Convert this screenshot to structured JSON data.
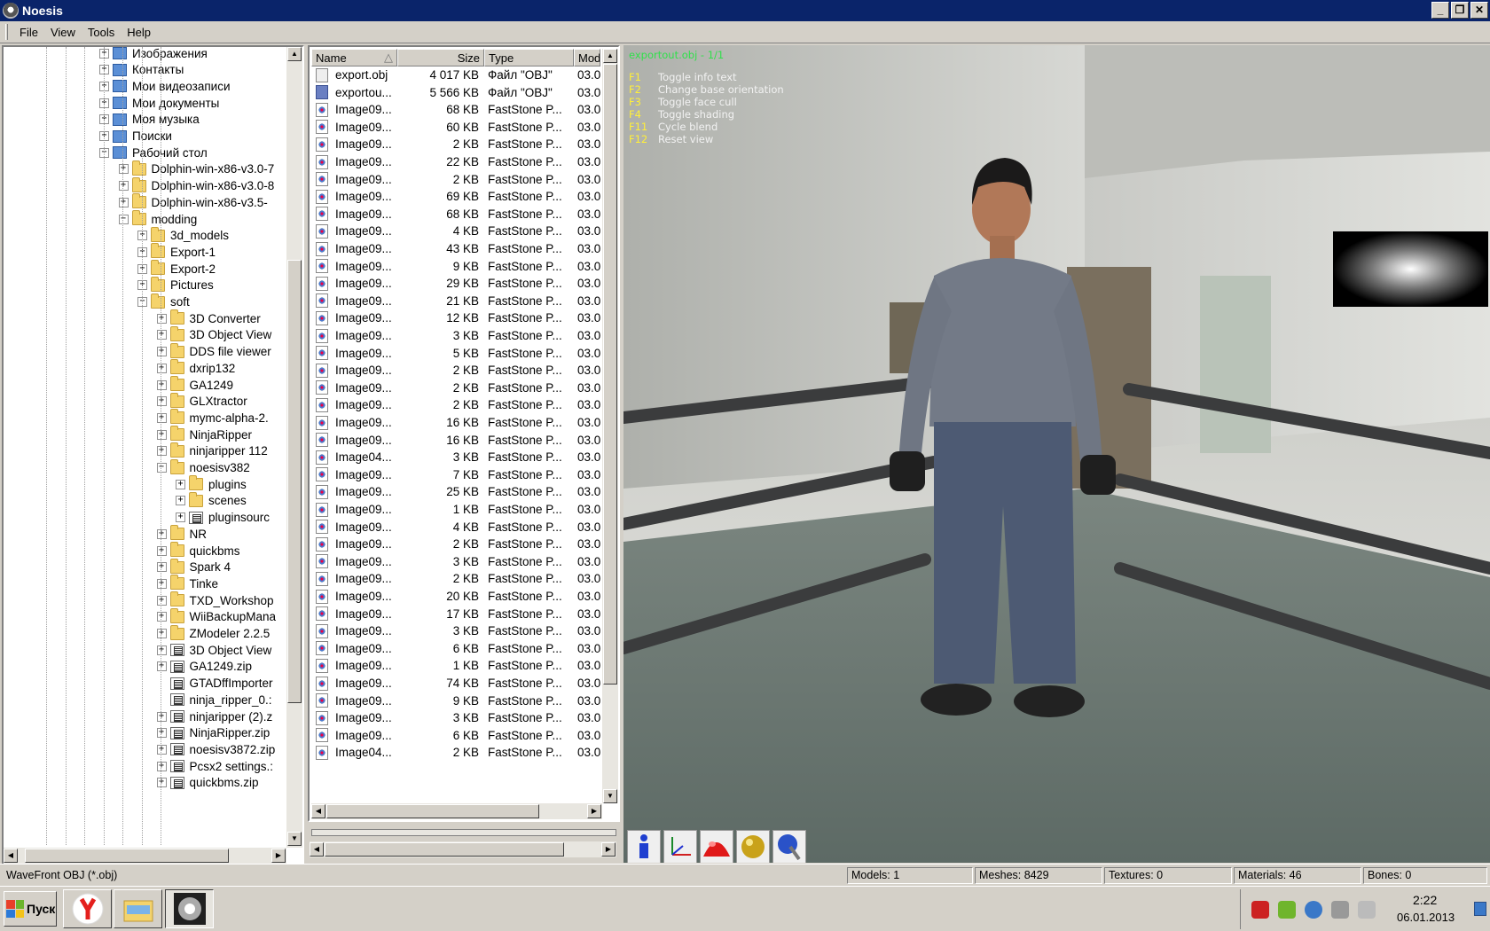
{
  "window": {
    "title": "Noesis",
    "min": "_",
    "max": "❐",
    "close": "✕"
  },
  "menu": [
    "File",
    "View",
    "Tools",
    "Help"
  ],
  "tree": {
    "items": [
      {
        "label": "Изображения",
        "icon": "sys",
        "exp": "+"
      },
      {
        "label": "Контакты",
        "icon": "sys",
        "exp": "+"
      },
      {
        "label": "Мои видеозаписи",
        "icon": "sys",
        "exp": "+"
      },
      {
        "label": "Мои документы",
        "icon": "sys",
        "exp": "+"
      },
      {
        "label": "Моя музыка",
        "icon": "sys",
        "exp": "+"
      },
      {
        "label": "Поиски",
        "icon": "sys",
        "exp": "+"
      },
      {
        "label": "Рабочий стол",
        "icon": "sys",
        "exp": "−"
      },
      {
        "label": "Dolphin-win-x86-v3.0-7",
        "icon": "folder",
        "exp": "+"
      },
      {
        "label": "Dolphin-win-x86-v3.0-8",
        "icon": "folder",
        "exp": "+"
      },
      {
        "label": "Dolphin-win-x86-v3.5-",
        "icon": "folder",
        "exp": "+"
      },
      {
        "label": "modding",
        "icon": "folder",
        "exp": "−"
      },
      {
        "label": "3d_models",
        "icon": "folder",
        "exp": "+"
      },
      {
        "label": "Export-1",
        "icon": "folder",
        "exp": "+"
      },
      {
        "label": "Export-2",
        "icon": "folder",
        "exp": "+"
      },
      {
        "label": "Pictures",
        "icon": "folder",
        "exp": "+"
      },
      {
        "label": "soft",
        "icon": "folder",
        "exp": "−"
      },
      {
        "label": "3D Converter",
        "icon": "folder",
        "exp": "+"
      },
      {
        "label": "3D Object View",
        "icon": "folder",
        "exp": "+"
      },
      {
        "label": "DDS file viewer",
        "icon": "folder",
        "exp": "+"
      },
      {
        "label": "dxrip132",
        "icon": "folder",
        "exp": "+"
      },
      {
        "label": "GA1249",
        "icon": "folder",
        "exp": "+"
      },
      {
        "label": "GLXtractor",
        "icon": "folder",
        "exp": "+"
      },
      {
        "label": "mymc-alpha-2.",
        "icon": "folder",
        "exp": "+"
      },
      {
        "label": "NinjaRipper",
        "icon": "folder",
        "exp": "+"
      },
      {
        "label": "ninjaripper 112",
        "icon": "folder",
        "exp": "+"
      },
      {
        "label": "noesisv382",
        "icon": "folder",
        "exp": "−"
      },
      {
        "label": "plugins",
        "icon": "folder",
        "exp": "+"
      },
      {
        "label": "scenes",
        "icon": "folder",
        "exp": "+"
      },
      {
        "label": "pluginsourc",
        "icon": "zip",
        "exp": "+"
      },
      {
        "label": "NR",
        "icon": "folder",
        "exp": "+"
      },
      {
        "label": "quickbms",
        "icon": "folder",
        "exp": "+"
      },
      {
        "label": "Spark 4",
        "icon": "folder",
        "exp": "+"
      },
      {
        "label": "Tinke",
        "icon": "folder",
        "exp": "+"
      },
      {
        "label": "TXD_Workshop",
        "icon": "folder",
        "exp": "+"
      },
      {
        "label": "WiiBackupMana",
        "icon": "folder",
        "exp": "+"
      },
      {
        "label": "ZModeler 2.2.5",
        "icon": "folder",
        "exp": "+"
      },
      {
        "label": "3D Object View",
        "icon": "zip",
        "exp": "+"
      },
      {
        "label": "GA1249.zip",
        "icon": "zip",
        "exp": "+"
      },
      {
        "label": "GTADffImporter",
        "icon": "zip",
        "exp": ""
      },
      {
        "label": "ninja_ripper_0.:",
        "icon": "zip",
        "exp": ""
      },
      {
        "label": "ninjaripper (2).z",
        "icon": "zip",
        "exp": "+"
      },
      {
        "label": "NinjaRipper.zip",
        "icon": "zip",
        "exp": "+"
      },
      {
        "label": "noesisv3872.zip",
        "icon": "zip",
        "exp": "+"
      },
      {
        "label": "Pcsx2 settings.:",
        "icon": "zip",
        "exp": "+"
      },
      {
        "label": "quickbms.zip",
        "icon": "zip",
        "exp": "+"
      }
    ]
  },
  "files": {
    "columns": [
      "Name",
      "Size",
      "Type",
      "Mod"
    ],
    "sort_indicator": "△",
    "rows": [
      {
        "name": "export.obj",
        "size": "4 017 KB",
        "type": "Файл \"OBJ\"",
        "mod": "03.0",
        "icon": "obj"
      },
      {
        "name": "exportou...",
        "size": "5 566 KB",
        "type": "Файл \"OBJ\"",
        "mod": "03.0",
        "icon": "objb"
      },
      {
        "name": "Image09...",
        "size": "68 KB",
        "type": "FastStone P...",
        "mod": "03.0",
        "icon": "img"
      },
      {
        "name": "Image09...",
        "size": "60 KB",
        "type": "FastStone P...",
        "mod": "03.0",
        "icon": "img"
      },
      {
        "name": "Image09...",
        "size": "2 KB",
        "type": "FastStone P...",
        "mod": "03.0",
        "icon": "img"
      },
      {
        "name": "Image09...",
        "size": "22 KB",
        "type": "FastStone P...",
        "mod": "03.0",
        "icon": "img"
      },
      {
        "name": "Image09...",
        "size": "2 KB",
        "type": "FastStone P...",
        "mod": "03.0",
        "icon": "img"
      },
      {
        "name": "Image09...",
        "size": "69 KB",
        "type": "FastStone P...",
        "mod": "03.0",
        "icon": "img"
      },
      {
        "name": "Image09...",
        "size": "68 KB",
        "type": "FastStone P...",
        "mod": "03.0",
        "icon": "img"
      },
      {
        "name": "Image09...",
        "size": "4 KB",
        "type": "FastStone P...",
        "mod": "03.0",
        "icon": "img"
      },
      {
        "name": "Image09...",
        "size": "43 KB",
        "type": "FastStone P...",
        "mod": "03.0",
        "icon": "img"
      },
      {
        "name": "Image09...",
        "size": "9 KB",
        "type": "FastStone P...",
        "mod": "03.0",
        "icon": "img"
      },
      {
        "name": "Image09...",
        "size": "29 KB",
        "type": "FastStone P...",
        "mod": "03.0",
        "icon": "img"
      },
      {
        "name": "Image09...",
        "size": "21 KB",
        "type": "FastStone P...",
        "mod": "03.0",
        "icon": "img"
      },
      {
        "name": "Image09...",
        "size": "12 KB",
        "type": "FastStone P...",
        "mod": "03.0",
        "icon": "img"
      },
      {
        "name": "Image09...",
        "size": "3 KB",
        "type": "FastStone P...",
        "mod": "03.0",
        "icon": "img"
      },
      {
        "name": "Image09...",
        "size": "5 KB",
        "type": "FastStone P...",
        "mod": "03.0",
        "icon": "img"
      },
      {
        "name": "Image09...",
        "size": "2 KB",
        "type": "FastStone P...",
        "mod": "03.0",
        "icon": "img"
      },
      {
        "name": "Image09...",
        "size": "2 KB",
        "type": "FastStone P...",
        "mod": "03.0",
        "icon": "img"
      },
      {
        "name": "Image09...",
        "size": "2 KB",
        "type": "FastStone P...",
        "mod": "03.0",
        "icon": "img"
      },
      {
        "name": "Image09...",
        "size": "16 KB",
        "type": "FastStone P...",
        "mod": "03.0",
        "icon": "img"
      },
      {
        "name": "Image09...",
        "size": "16 KB",
        "type": "FastStone P...",
        "mod": "03.0",
        "icon": "img"
      },
      {
        "name": "Image04...",
        "size": "3 KB",
        "type": "FastStone P...",
        "mod": "03.0",
        "icon": "img"
      },
      {
        "name": "Image09...",
        "size": "7 KB",
        "type": "FastStone P...",
        "mod": "03.0",
        "icon": "img"
      },
      {
        "name": "Image09...",
        "size": "25 KB",
        "type": "FastStone P...",
        "mod": "03.0",
        "icon": "img"
      },
      {
        "name": "Image09...",
        "size": "1 KB",
        "type": "FastStone P...",
        "mod": "03.0",
        "icon": "img"
      },
      {
        "name": "Image09...",
        "size": "4 KB",
        "type": "FastStone P...",
        "mod": "03.0",
        "icon": "img"
      },
      {
        "name": "Image09...",
        "size": "2 KB",
        "type": "FastStone P...",
        "mod": "03.0",
        "icon": "img"
      },
      {
        "name": "Image09...",
        "size": "3 KB",
        "type": "FastStone P...",
        "mod": "03.0",
        "icon": "img"
      },
      {
        "name": "Image09...",
        "size": "2 KB",
        "type": "FastStone P...",
        "mod": "03.0",
        "icon": "img"
      },
      {
        "name": "Image09...",
        "size": "20 KB",
        "type": "FastStone P...",
        "mod": "03.0",
        "icon": "img"
      },
      {
        "name": "Image09...",
        "size": "17 KB",
        "type": "FastStone P...",
        "mod": "03.0",
        "icon": "img"
      },
      {
        "name": "Image09...",
        "size": "3 KB",
        "type": "FastStone P...",
        "mod": "03.0",
        "icon": "img"
      },
      {
        "name": "Image09...",
        "size": "6 KB",
        "type": "FastStone P...",
        "mod": "03.0",
        "icon": "img"
      },
      {
        "name": "Image09...",
        "size": "1 KB",
        "type": "FastStone P...",
        "mod": "03.0",
        "icon": "img"
      },
      {
        "name": "Image09...",
        "size": "74 KB",
        "type": "FastStone P...",
        "mod": "03.0",
        "icon": "img"
      },
      {
        "name": "Image09...",
        "size": "9 KB",
        "type": "FastStone P...",
        "mod": "03.0",
        "icon": "img"
      },
      {
        "name": "Image09...",
        "size": "3 KB",
        "type": "FastStone P...",
        "mod": "03.0",
        "icon": "img"
      },
      {
        "name": "Image09...",
        "size": "6 KB",
        "type": "FastStone P...",
        "mod": "03.0",
        "icon": "img"
      },
      {
        "name": "Image04...",
        "size": "2 KB",
        "type": "FastStone P...",
        "mod": "03.0",
        "icon": "img"
      }
    ]
  },
  "viewer": {
    "info": "exportout.obj - 1/1",
    "help": [
      {
        "key": "F1",
        "label": "Toggle info text"
      },
      {
        "key": "F2",
        "label": "Change base orientation"
      },
      {
        "key": "F3",
        "label": "Toggle face cull"
      },
      {
        "key": "F4",
        "label": "Toggle shading"
      },
      {
        "key": "F11",
        "label": "Cycle blend"
      },
      {
        "key": "F12",
        "label": "Reset view"
      }
    ],
    "tools": [
      "info-icon",
      "axes-icon",
      "red-dome-icon",
      "gold-sphere-icon",
      "blue-sphere-brush-icon"
    ]
  },
  "status": {
    "format": "WaveFront OBJ (*.obj)",
    "models": "Models: 1",
    "meshes": "Meshes: 8429",
    "textures": "Textures: 0",
    "materials": "Materials: 46",
    "bones": "Bones: 0"
  },
  "taskbar": {
    "start": "Пуск",
    "time": "2:22",
    "date": "06.01.2013"
  },
  "colors": {
    "titlebar": "#0a246a",
    "info_text": "#31e04b",
    "help_key": "#ffef3a"
  }
}
